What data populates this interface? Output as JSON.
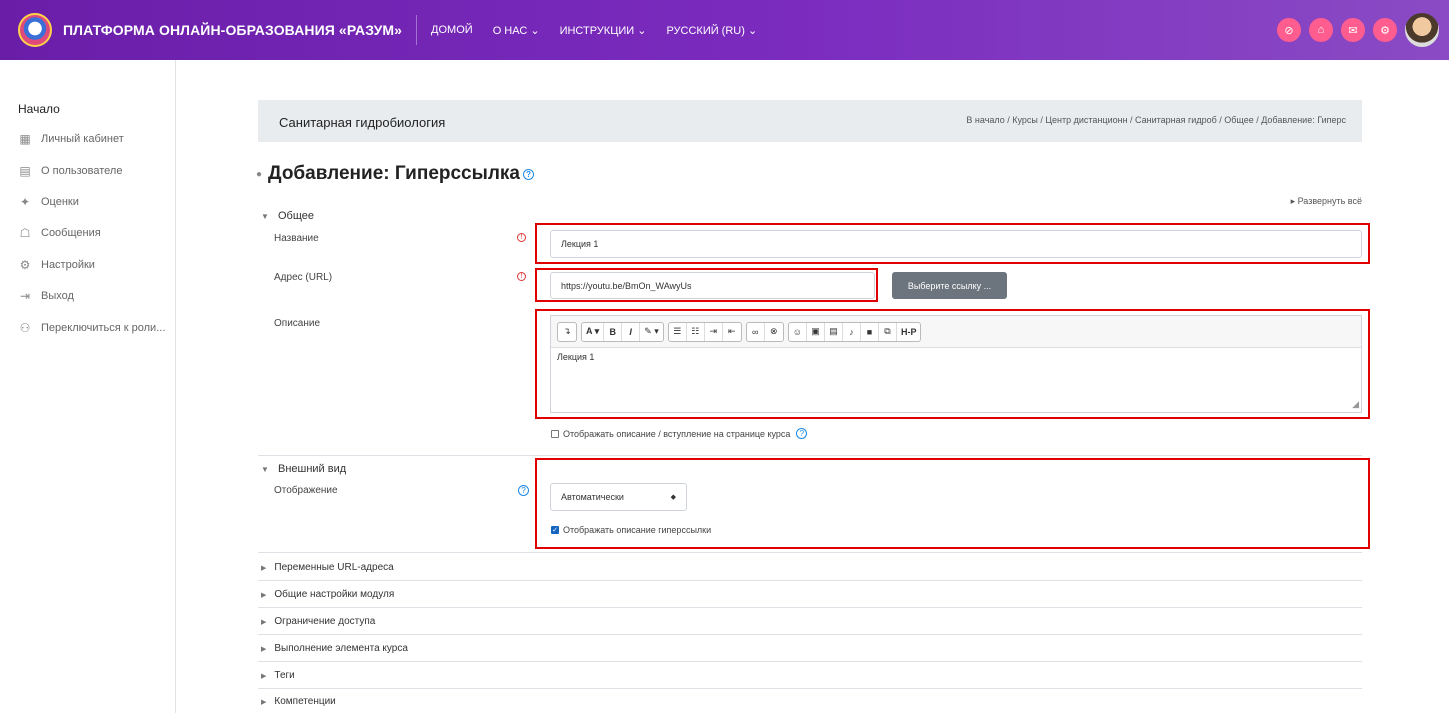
{
  "navbar": {
    "brand": "ПЛАТФОРМА ОНЛАЙН-ОБРАЗОВАНИЯ «РАЗУМ»",
    "links": [
      "ДОМОЙ",
      "О НАС ⌄",
      "ИНСТРУКЦИИ ⌄",
      "РУССКИЙ (RU) ⌄"
    ]
  },
  "sidebar": {
    "title": "Начало",
    "items": [
      {
        "label": "Личный кабинет",
        "icon": "dashboard-icon"
      },
      {
        "label": "О пользователе",
        "icon": "user-card-icon"
      },
      {
        "label": "Оценки",
        "icon": "grades-icon"
      },
      {
        "label": "Сообщения",
        "icon": "messages-icon"
      },
      {
        "label": "Настройки",
        "icon": "gear-icon"
      },
      {
        "label": "Выход",
        "icon": "logout-icon"
      },
      {
        "label": "Переключиться к роли...",
        "icon": "switch-role-icon"
      }
    ]
  },
  "header": {
    "course_title": "Санитарная гидробиология",
    "breadcrumb": "В начало / Курсы / Центр дистанционн / Санитарная гидроб / Общее / Добавление: Гиперс"
  },
  "page": {
    "title": "Добавление: Гиперссылка",
    "expand_all": "▸ Развернуть всё"
  },
  "form": {
    "section_general": "Общее",
    "name_label": "Название",
    "name_value": "Лекция 1",
    "url_label": "Адрес (URL)",
    "url_value": "https://youtu.be/BmOn_WAwyUs",
    "choose_link_button": "Выберите ссылку ...",
    "description_label": "Описание",
    "description_value": "Лекция 1",
    "show_description_label": "Отображать описание / вступление на странице курса",
    "section_appearance": "Внешний вид",
    "display_label": "Отображение",
    "display_value": "Автоматически",
    "show_link_description_label": "Отображать описание гиперссылки"
  },
  "collapsed_sections": [
    "Переменные URL-адреса",
    "Общие настройки модуля",
    "Ограничение доступа",
    "Выполнение элемента курса",
    "Теги",
    "Компетенции"
  ],
  "colors": {
    "navbar_start": "#6a1ea8",
    "navbar_end": "#8a4bc4",
    "icon_button": "#ff5d8f",
    "highlight_box": "#e00000"
  }
}
